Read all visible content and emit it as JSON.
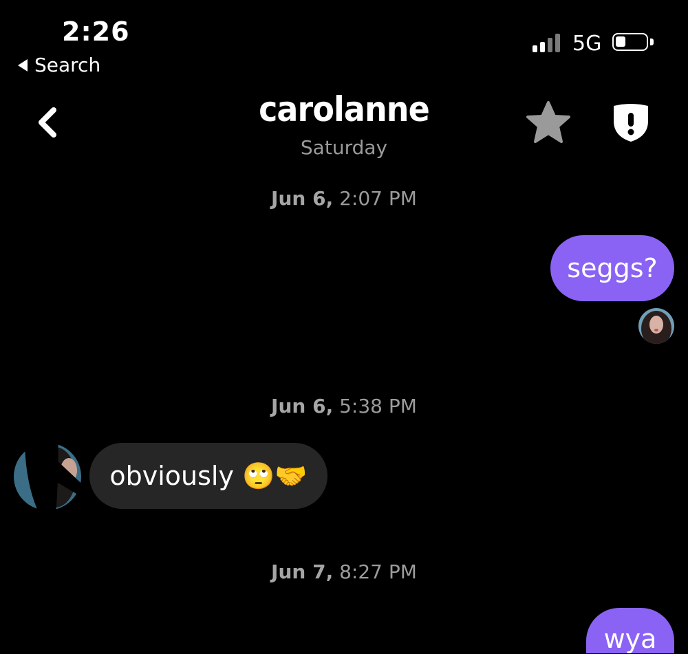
{
  "status_bar": {
    "time": "2:26",
    "back_app_label": "Search",
    "network": "5G",
    "signal_bars_filled": 2,
    "signal_bars_total": 4,
    "battery_level": 0.25
  },
  "header": {
    "contact_name": "carolanne",
    "last_active": "Saturday",
    "back_icon": "chevron-left-icon",
    "favorite_icon": "star-icon",
    "safety_icon": "shield-alert-icon"
  },
  "conversation": {
    "timestamps": [
      {
        "date": "Jun 6,",
        "time": "2:07 PM"
      },
      {
        "date": "Jun 6,",
        "time": "5:38 PM"
      },
      {
        "date": "Jun 7,",
        "time": "8:27 PM"
      }
    ],
    "messages": [
      {
        "from": "me",
        "text": "seggs?"
      },
      {
        "from": "them",
        "text": "obviously 🙄🤝"
      },
      {
        "from": "me",
        "text": "wya"
      }
    ]
  },
  "colors": {
    "background": "#000000",
    "outgoing_bubble": "#8a63f5",
    "incoming_bubble": "#262626",
    "muted_text": "#9a9a9a"
  }
}
